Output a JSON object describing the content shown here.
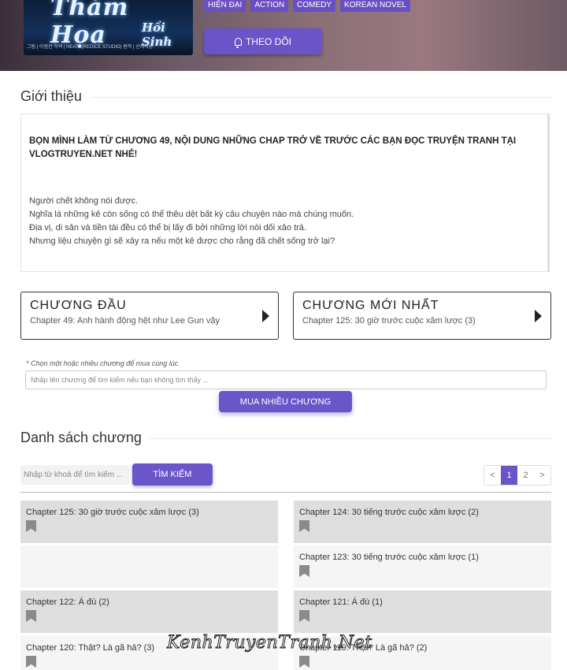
{
  "cover": {
    "title": "Thảm Họa",
    "subtitle": "Hồi Sinh",
    "credits": "그림 | 이범선     각색 | HEATS(REDICE STUDIO)     원작 | 산지직송"
  },
  "genres": [
    "HIỆN ĐẠI",
    "ACTION",
    "COMEDY",
    "KOREAN NOVEL"
  ],
  "follow_label": "THEO DÕI",
  "intro": {
    "heading": "Giới thiệu",
    "notice": "BỌN MÌNH LÀM TỪ CHƯƠNG 49, NỘI DUNG NHỮNG CHAP TRỞ VỀ TRƯỚC CÁC BẠN ĐỌC TRUYỆN TRANH TẠI VLOGTRUYEN.NET NHÉ!",
    "lines": [
      "Người chết không nói được.",
      "Nghĩa là những kẻ còn sống có thể thêu dệt bất kỳ câu chuyện nào mà chúng muốn.",
      "Địa vị, di sản và tiền tài đều có thể bị lấy đi bởi những lời nói dối xảo trá.",
      "Nhưng liệu chuyện gì sẽ xảy ra nếu một kẻ được cho rằng đã chết sống trở lại?"
    ]
  },
  "first_chapter": {
    "heading": "CHƯƠNG ĐẦU",
    "title": "Chapter 49: Anh hành động hệt như Lee Gun vậy"
  },
  "latest_chapter": {
    "heading": "CHƯƠNG MỚI NHẤT",
    "title": "Chapter 125: 30 giờ trước cuộc xâm lược (3)"
  },
  "buy": {
    "note": "* Chọn một hoặc nhiều chương để mua cùng lúc",
    "placeholder": "Nhập tên chương để tìm kiếm nếu bạn không tìm thấy ...",
    "button": "MUA NHIỀU CHƯƠNG"
  },
  "chapter_list": {
    "heading": "Danh sách chương",
    "search_placeholder": "Nhập từ khoá để tìm kiếm ...",
    "search_button": "TÌM KIẾM",
    "pagination": [
      "<",
      "1",
      "2",
      ">"
    ],
    "active_page": "1",
    "items": [
      "Chapter 125: 30 giờ trước cuộc xâm lược (3)",
      "Chapter 124: 30 tiếng trước cuộc xâm lược (2)",
      "",
      "Chapter 123: 30 tiếng trước cuộc xâm lược (1)",
      "Chapter 122: Á đù (2)",
      "Chapter 121: Á đù (1)",
      "Chapter 120: Thật? Là gã hả? (3)",
      "Chapter 119: Thật? Là gã hả? (2)"
    ]
  },
  "watermark": "KenhTruyenTranh.Net",
  "colors": {
    "accent": "#6a54c8",
    "row_gray": "#dedede",
    "row_light": "#f5f5f5"
  }
}
